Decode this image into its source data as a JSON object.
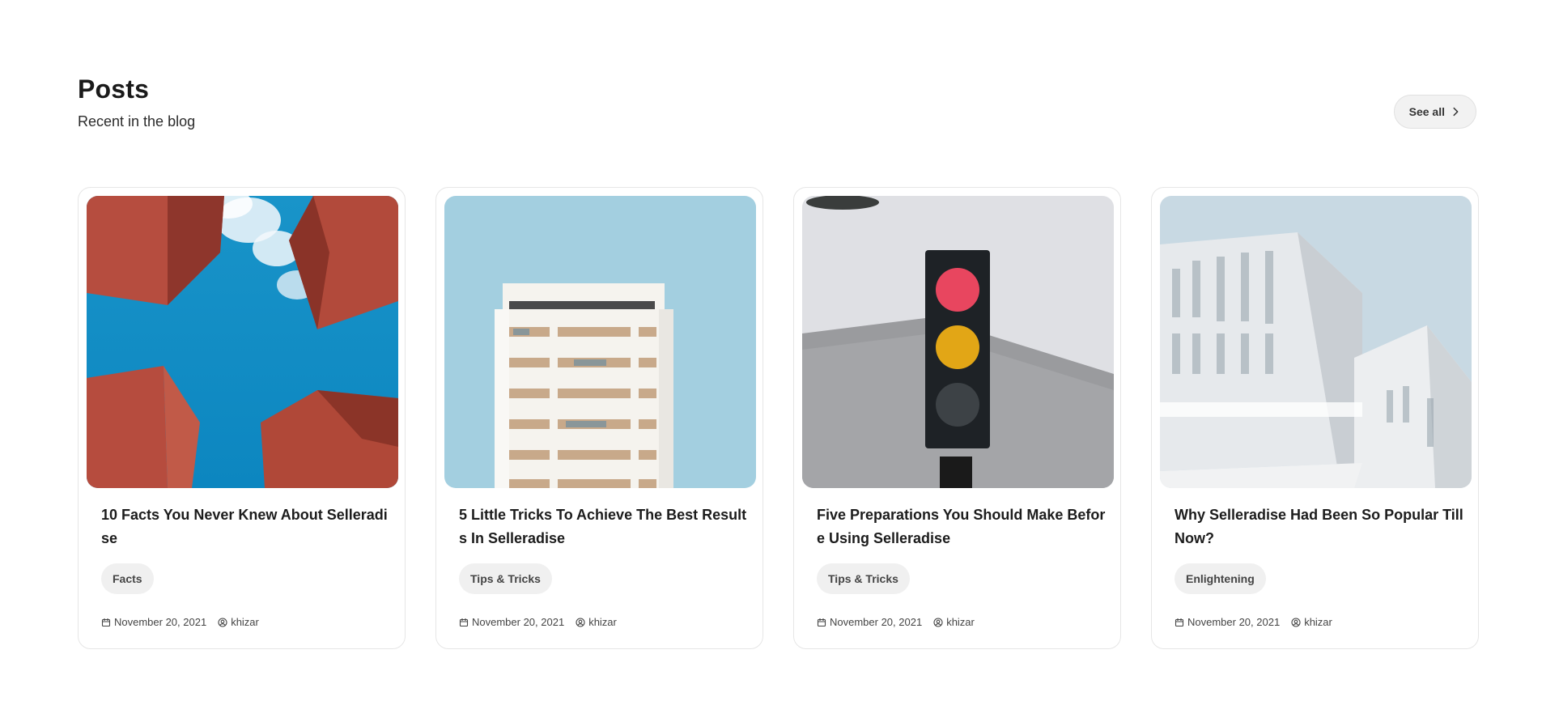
{
  "section": {
    "title": "Posts",
    "subtitle": "Recent in the blog",
    "see_all_label": "See all"
  },
  "posts": [
    {
      "title": "10 Facts You Never Knew About Selleradise",
      "tag": "Facts",
      "date": "November 20, 2021",
      "author": "khizar",
      "image": "red-sculpture-sky"
    },
    {
      "title": "5 Little Tricks To Achieve The Best Results In Selleradise",
      "tag": "Tips & Tricks",
      "date": "November 20, 2021",
      "author": "khizar",
      "image": "white-building-sky"
    },
    {
      "title": "Five Preparations You Should Make Before Using Selleradise",
      "tag": "Tips & Tricks",
      "date": "November 20, 2021",
      "author": "khizar",
      "image": "traffic-light"
    },
    {
      "title": "Why Selleradise Had Been So Popular Till Now?",
      "tag": "Enlightening",
      "date": "November 20, 2021",
      "author": "khizar",
      "image": "white-modern-building"
    }
  ],
  "icons": {
    "chevron": "chevron-right-icon",
    "calendar": "calendar-icon",
    "user": "user-circle-icon"
  },
  "colors": {
    "card_border": "#e6e6e6",
    "tag_bg": "#f0f0f0",
    "button_bg": "#f2f2f2"
  }
}
